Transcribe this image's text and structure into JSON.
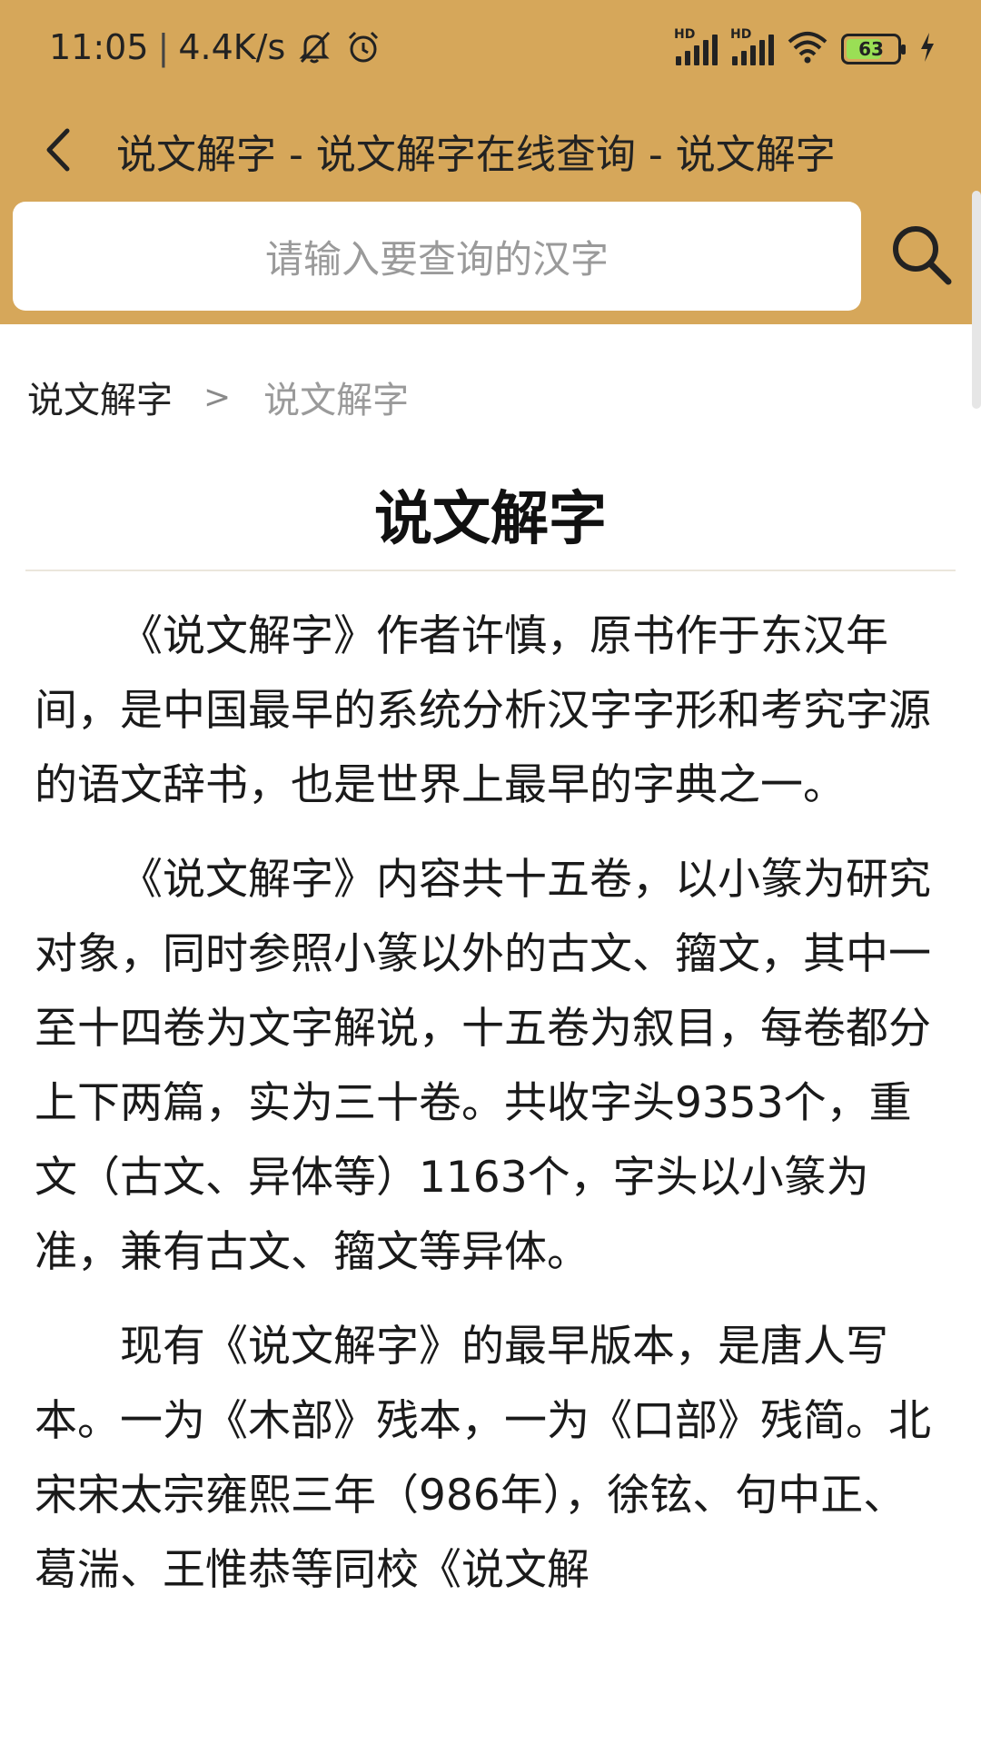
{
  "status_bar": {
    "time": "11:05",
    "net_speed": "4.4K/s",
    "signal_1_label": "HD",
    "signal_2_label": "HD",
    "battery_level": "63",
    "icons": [
      "mute-notification-icon",
      "alarm-icon",
      "signal-icon",
      "wifi-icon",
      "battery-icon",
      "charging-icon"
    ]
  },
  "header": {
    "title": "说文解字 - 说文解字在线查询 - 说文解字",
    "background_color": "#d6a75a"
  },
  "search": {
    "placeholder": "请输入要查询的汉字"
  },
  "breadcrumb": {
    "root": "说文解字",
    "separator": ">",
    "current": "说文解字"
  },
  "article": {
    "title": "说文解字",
    "paragraphs": [
      "《说文解字》作者许慎，原书作于东汉年间，是中国最早的系统分析汉字字形和考究字源的语文辞书，也是世界上最早的字典之一。",
      "《说文解字》内容共十五卷，以小篆为研究对象，同时参照小篆以外的古文、籀文，其中一至十四卷为文字解说，十五卷为叙目，每卷都分上下两篇，实为三十卷。共收字头9353个，重文（古文、异体等）1163个，字头以小篆为准，兼有古文、籀文等异体。",
      "现有《说文解字》的最早版本，是唐人写本。一为《木部》残本，一为《口部》残简。北宋宋太宗雍熙三年（986年），徐铉、句中正、葛湍、王惟恭等同校《说文解"
    ]
  }
}
